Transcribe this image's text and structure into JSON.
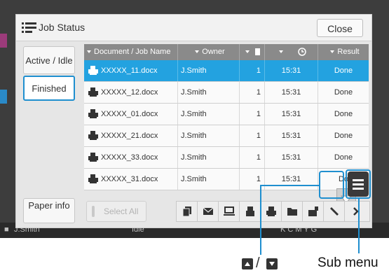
{
  "dialog": {
    "title": "Job Status",
    "close_label": "Close"
  },
  "left_tabs": [
    {
      "label": "Active / Idle",
      "active": false
    },
    {
      "label": "Finished",
      "active": true
    }
  ],
  "paper_info_label": "Paper info",
  "table": {
    "headers": [
      "Document / Job Name",
      "Owner",
      "",
      "",
      "Result"
    ],
    "rows": [
      {
        "name": "XXXXX_11.docx",
        "owner": "J.Smith",
        "copies": "1",
        "time": "15:31",
        "result": "Done",
        "selected": true
      },
      {
        "name": "XXXXX_12.docx",
        "owner": "J.Smith",
        "copies": "1",
        "time": "15:31",
        "result": "Done",
        "selected": false
      },
      {
        "name": "XXXXX_01.docx",
        "owner": "J.Smith",
        "copies": "1",
        "time": "15:31",
        "result": "Done",
        "selected": false
      },
      {
        "name": "XXXXX_21.docx",
        "owner": "J.Smith",
        "copies": "1",
        "time": "15:31",
        "result": "Done",
        "selected": false
      },
      {
        "name": "XXXXX_33.docx",
        "owner": "J.Smith",
        "copies": "1",
        "time": "15:31",
        "result": "Done",
        "selected": false
      },
      {
        "name": "XXXXX_31.docx",
        "owner": "J.Smith",
        "copies": "1",
        "time": "15:31",
        "result": "Do",
        "selected": false
      }
    ]
  },
  "select_all_label": "Select All",
  "toolbar_icons": [
    "copy-icon",
    "mail-icon",
    "computer-icon",
    "fax-icon",
    "print-icon",
    "folder-icon",
    "box-icon",
    "stapler-icon",
    "more-icon"
  ],
  "status_bar": {
    "user": "J.Smith",
    "state": "Idle",
    "toner": "K C M Y G"
  },
  "callouts": {
    "scroll_label": "/",
    "submenu_label": "Sub menu"
  },
  "colors": {
    "accent": "#1f8fcf",
    "selected_row": "#23a2e0",
    "header": "#8a8a8a"
  }
}
